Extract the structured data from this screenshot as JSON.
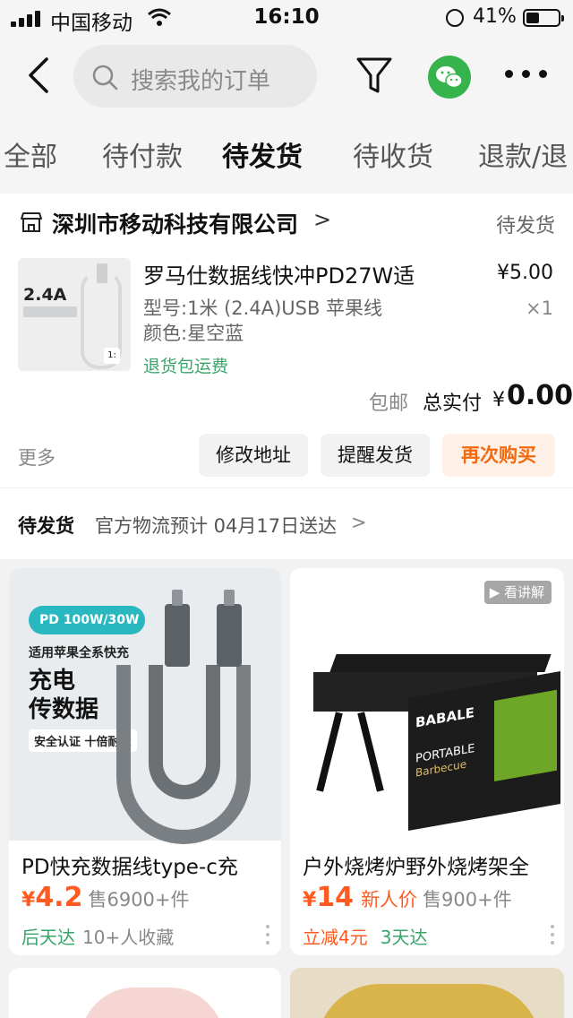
{
  "status_bar": {
    "carrier": "中国移动",
    "time": "16:10",
    "battery": "41%"
  },
  "header": {
    "search_placeholder": "搜索我的订单",
    "icons": [
      "back-arrow-icon",
      "filter-icon",
      "wechat-icon",
      "more-icon"
    ]
  },
  "tabs": [
    {
      "label": "全部",
      "active": false
    },
    {
      "label": "待付款",
      "active": false
    },
    {
      "label": "待发货",
      "active": true
    },
    {
      "label": "待收货",
      "active": false
    },
    {
      "label": "退款/退",
      "active": false
    }
  ],
  "order": {
    "store_name": "深圳市移动科技有限公司",
    "store_arrow": ">",
    "status": "待发货",
    "thumb_text": "2.4A",
    "thumb_tag": "1:",
    "product_title": "罗马仕数据线快冲PD27W适",
    "price": "¥5.00",
    "spec": "型号:1米 (2.4A)USB 苹果线",
    "color": "颜色:星空蓝",
    "quantity": "×1",
    "return_note": "退货包运费",
    "shipping": "包邮",
    "total_label": "总实付",
    "total_symbol": "¥",
    "total_value": "0.00",
    "more": "更多",
    "buttons": {
      "modify_address": "修改地址",
      "remind_ship": "提醒发货",
      "buy_again": "再次购买"
    }
  },
  "delivery": {
    "tag": "待发货",
    "info": "官方物流预计 04月17日送达",
    "arrow": ">"
  },
  "recommendations": [
    {
      "image_text": {
        "pill": "PD 100W/30W",
        "line1": "适用苹果全系快充",
        "line2": "充电",
        "line3": "传数据",
        "badge": "安全认证 十倍耐造"
      },
      "title": "PD快充数据线type-c充",
      "price_symbol": "¥",
      "price": "4.2",
      "sold": "售6900+件",
      "promo": "",
      "tag1": "后天达",
      "tag2": "10+人收藏"
    },
    {
      "image_text": {
        "explain": "▶ 看讲解",
        "brand": "BABALE",
        "sub1": "PORTABLE",
        "sub2": "Barbecue"
      },
      "title": "户外烧烤炉野外烧烤架全",
      "price_symbol": "¥",
      "price": "14",
      "promo": "新人价",
      "sold": "售900+件",
      "tag1": "立减4元",
      "tag2": "3天达"
    }
  ],
  "colors": {
    "accent_orange": "#ff5a1f",
    "accent_green": "#3aa56a",
    "wechat_green": "#36b34d",
    "background": "#f2f2f2"
  }
}
